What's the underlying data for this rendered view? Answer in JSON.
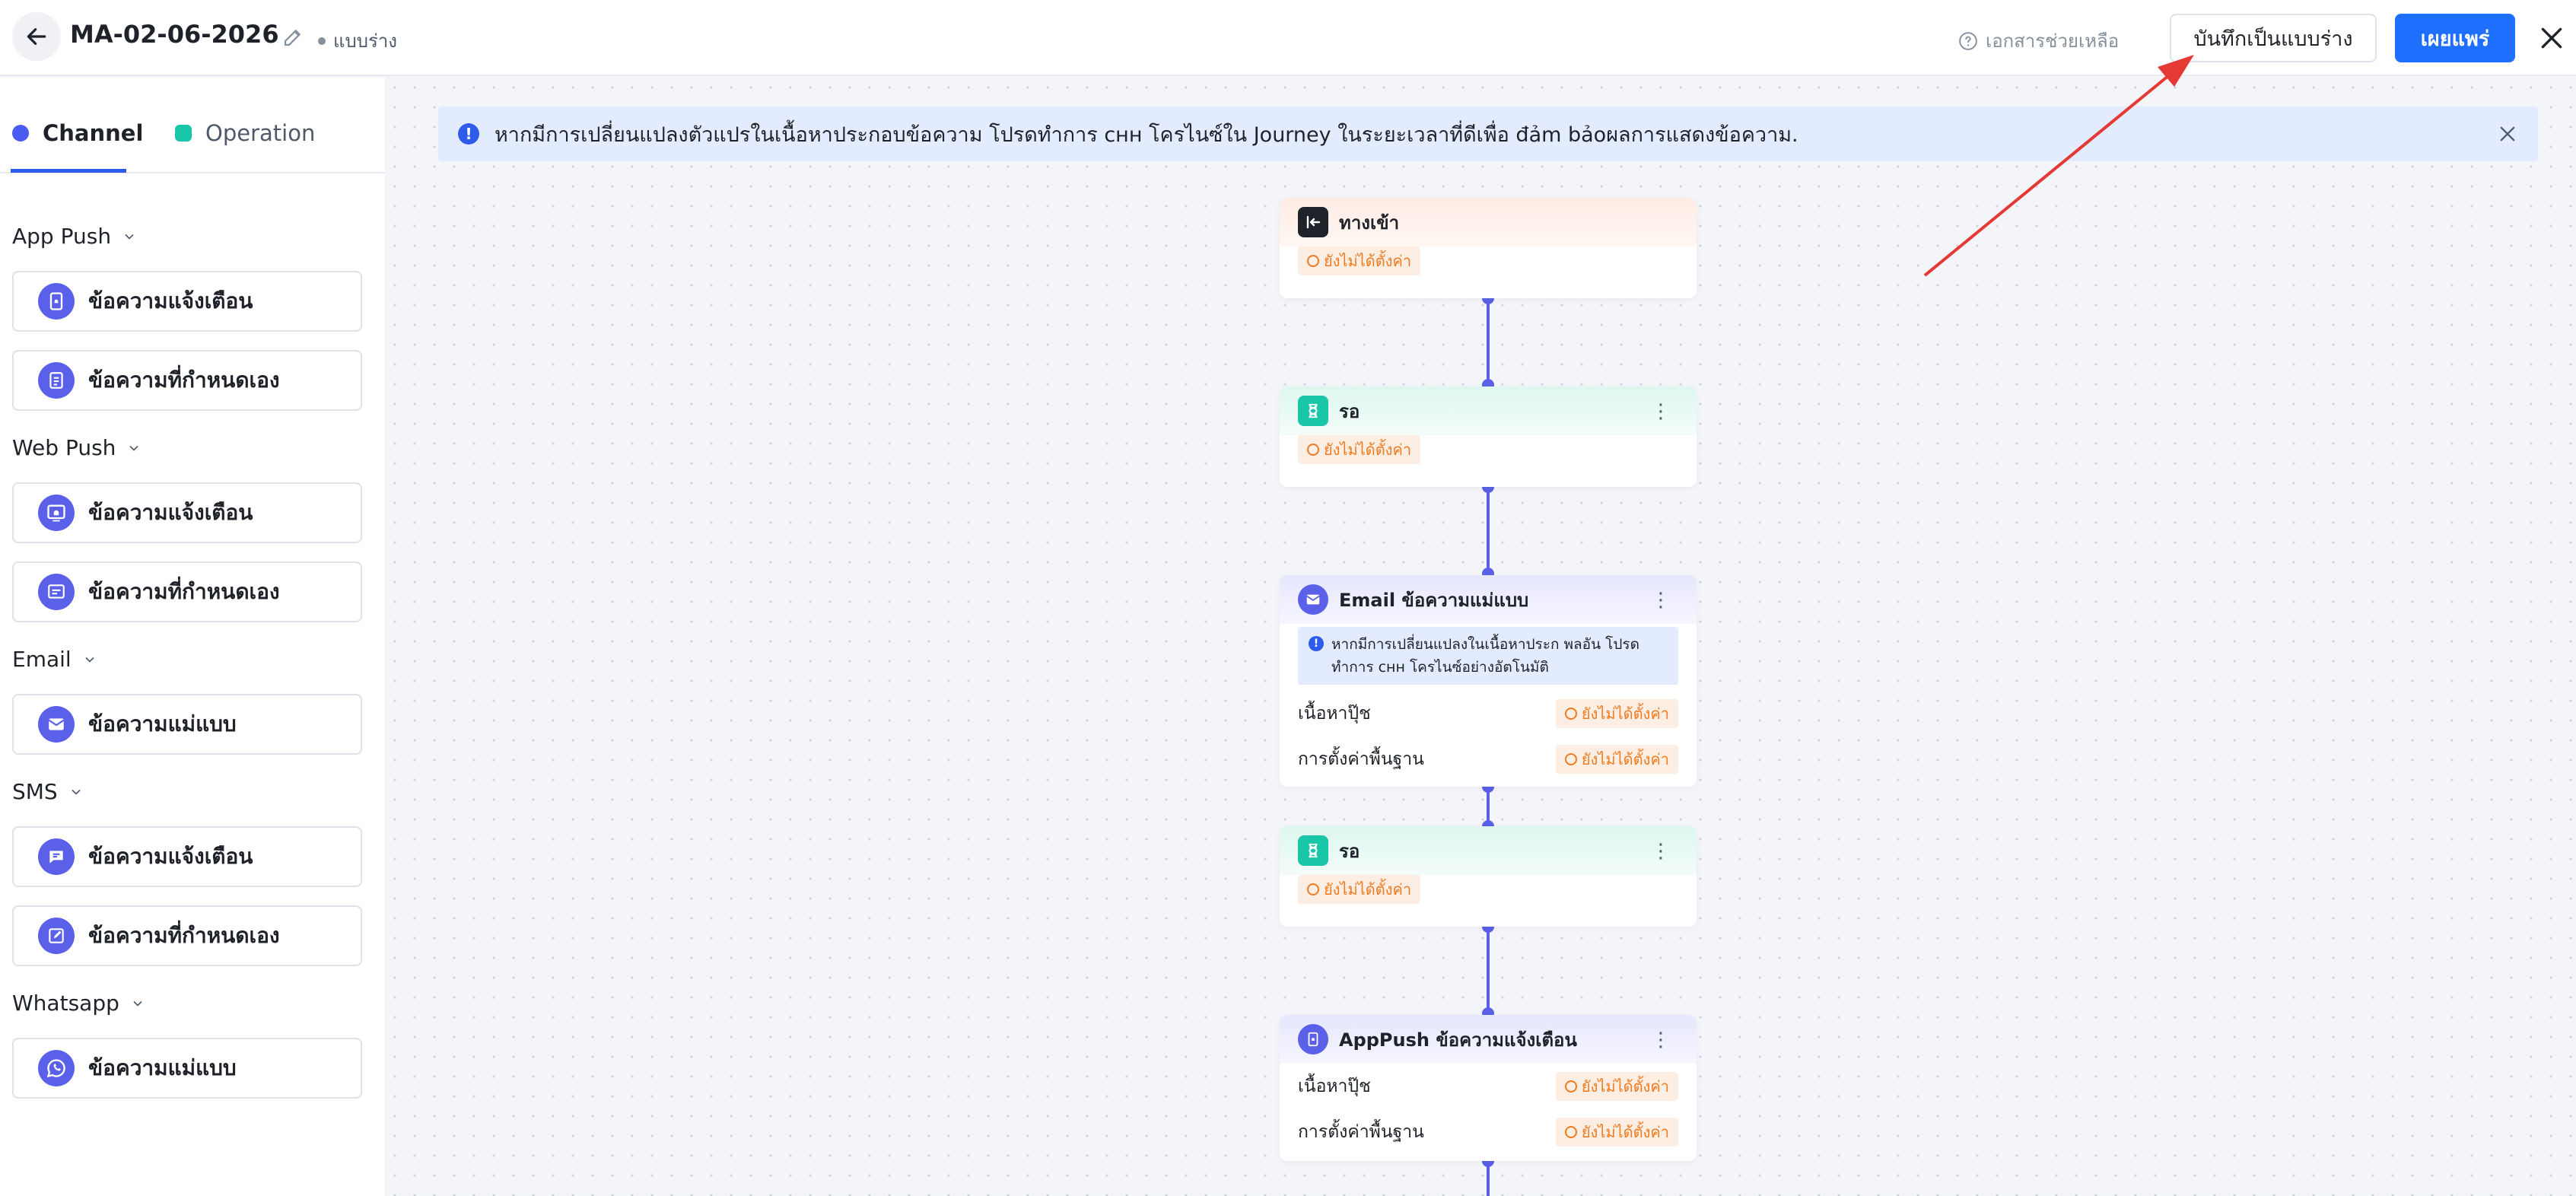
{
  "header": {
    "title": "MA-02-06-2026",
    "status": "แบบร่าง",
    "help": "เอกสารช่วยเหลือ",
    "save_draft": "บันทึกเป็นแบบร่าง",
    "publish": "เผยแพร่"
  },
  "sidebar": {
    "tabs": [
      {
        "label": "Channel"
      },
      {
        "label": "Operation"
      }
    ],
    "groups": [
      {
        "title": "App Push",
        "items": [
          {
            "label": "ข้อความแจ้งเตือน",
            "icon": "app-bell-icon"
          },
          {
            "label": "ข้อความที่กำหนดเอง",
            "icon": "document-icon"
          }
        ]
      },
      {
        "title": "Web Push",
        "items": [
          {
            "label": "ข้อความแจ้งเตือน",
            "icon": "web-bell-icon"
          },
          {
            "label": "ข้อความที่กำหนดเอง",
            "icon": "message-icon"
          }
        ]
      },
      {
        "title": "Email",
        "items": [
          {
            "label": "ข้อความแม่แบบ",
            "icon": "mail-icon"
          }
        ]
      },
      {
        "title": "SMS",
        "items": [
          {
            "label": "ข้อความแจ้งเตือน",
            "icon": "sms-icon"
          },
          {
            "label": "ข้อความที่กำหนดเอง",
            "icon": "edit-message-icon"
          }
        ]
      },
      {
        "title": "Whatsapp",
        "items": [
          {
            "label": "ข้อความแม่แบบ",
            "icon": "whatsapp-icon"
          }
        ]
      }
    ]
  },
  "banner": {
    "text": "หากมีการเปลี่ยนแปลงตัวแปรในเนื้อหาประกอบข้อความ โปรดทำการ cнн โครไนซ์ใน Journey ในระยะเวลาที่ดีเพื่อ đảm bảoผลการแสดงข้อความ."
  },
  "flow": {
    "nodes": [
      {
        "title": "ทางเข้า",
        "badge": "ยังไม่ได้ตั้งค่า"
      },
      {
        "title": "รอ",
        "badge": "ยังไม่ได้ตั้งค่า"
      },
      {
        "title": "Email ข้อความแม่แบบ",
        "info": "หากมีการเปลี่ยนแปลงในเนื้อหาประก พลอัน โปรดทำการ cнн โครไนซ์อย่างอัตโนมัติ",
        "rows": [
          {
            "label": "เนื้อหาปุ๊ช",
            "badge": "ยังไม่ได้ตั้งค่า"
          },
          {
            "label": "การตั้งค่าพื้นฐาน",
            "badge": "ยังไม่ได้ตั้งค่า"
          }
        ]
      },
      {
        "title": "รอ",
        "badge": "ยังไม่ได้ตั้งค่า"
      },
      {
        "title": "AppPush ข้อความแจ้งเตือน",
        "rows": [
          {
            "label": "เนื้อหาปุ๊ช",
            "badge": "ยังไม่ได้ตั้งค่า"
          },
          {
            "label": "การตั้งค่าพื้นฐาน",
            "badge": "ยังไม่ได้ตั้งค่า"
          }
        ]
      }
    ]
  },
  "colors": {
    "accent": "#1f6fff",
    "node_purple": "#5a61e8",
    "node_green": "#19c6a7",
    "badge_orange": "#f07b1e",
    "annotation_arrow": "#e53935"
  }
}
